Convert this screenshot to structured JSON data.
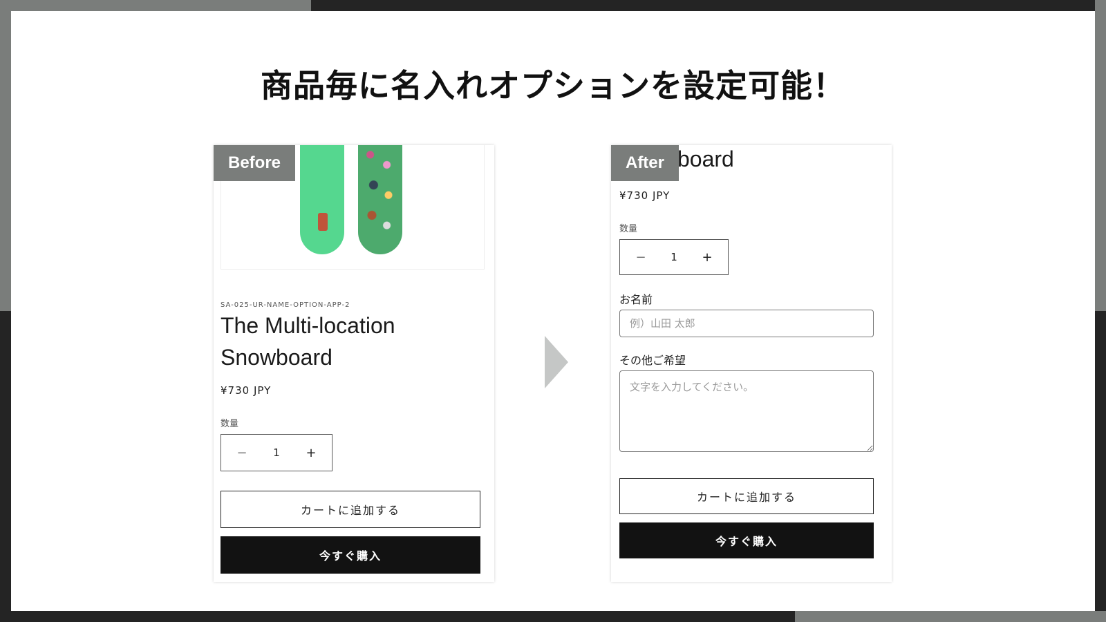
{
  "headline": "商品毎に名入れオプションを設定可能！",
  "before": {
    "tag": "Before",
    "sku": "SA-025-UR-NAME-OPTION-APP-2",
    "title_line1": "The Multi-location",
    "title_line2": "Snowboard",
    "price": "¥730 JPY",
    "qty_label": "数量",
    "qty_minus": "−",
    "qty_value": "1",
    "qty_plus": "+",
    "add_to_cart": "カートに追加する",
    "buy_now": "今すぐ購入"
  },
  "after": {
    "tag": "After",
    "title_fragment": "board",
    "price": "¥730 JPY",
    "qty_label": "数量",
    "qty_minus": "−",
    "qty_value": "1",
    "qty_plus": "+",
    "name_label": "お名前",
    "name_placeholder": "例）山田 太郎",
    "other_label": "その他ご希望",
    "other_placeholder": "文字を入力してください。",
    "add_to_cart": "カートに追加する",
    "buy_now": "今すぐ購入"
  },
  "colors": {
    "frame_dark": "#242424",
    "frame_gray": "#7a7d7b",
    "tag_bg": "#7a7d7b",
    "buy_button": "#121212",
    "arrow": "#c5c7c6"
  },
  "icons": {
    "transition": "chevron-right-icon"
  }
}
